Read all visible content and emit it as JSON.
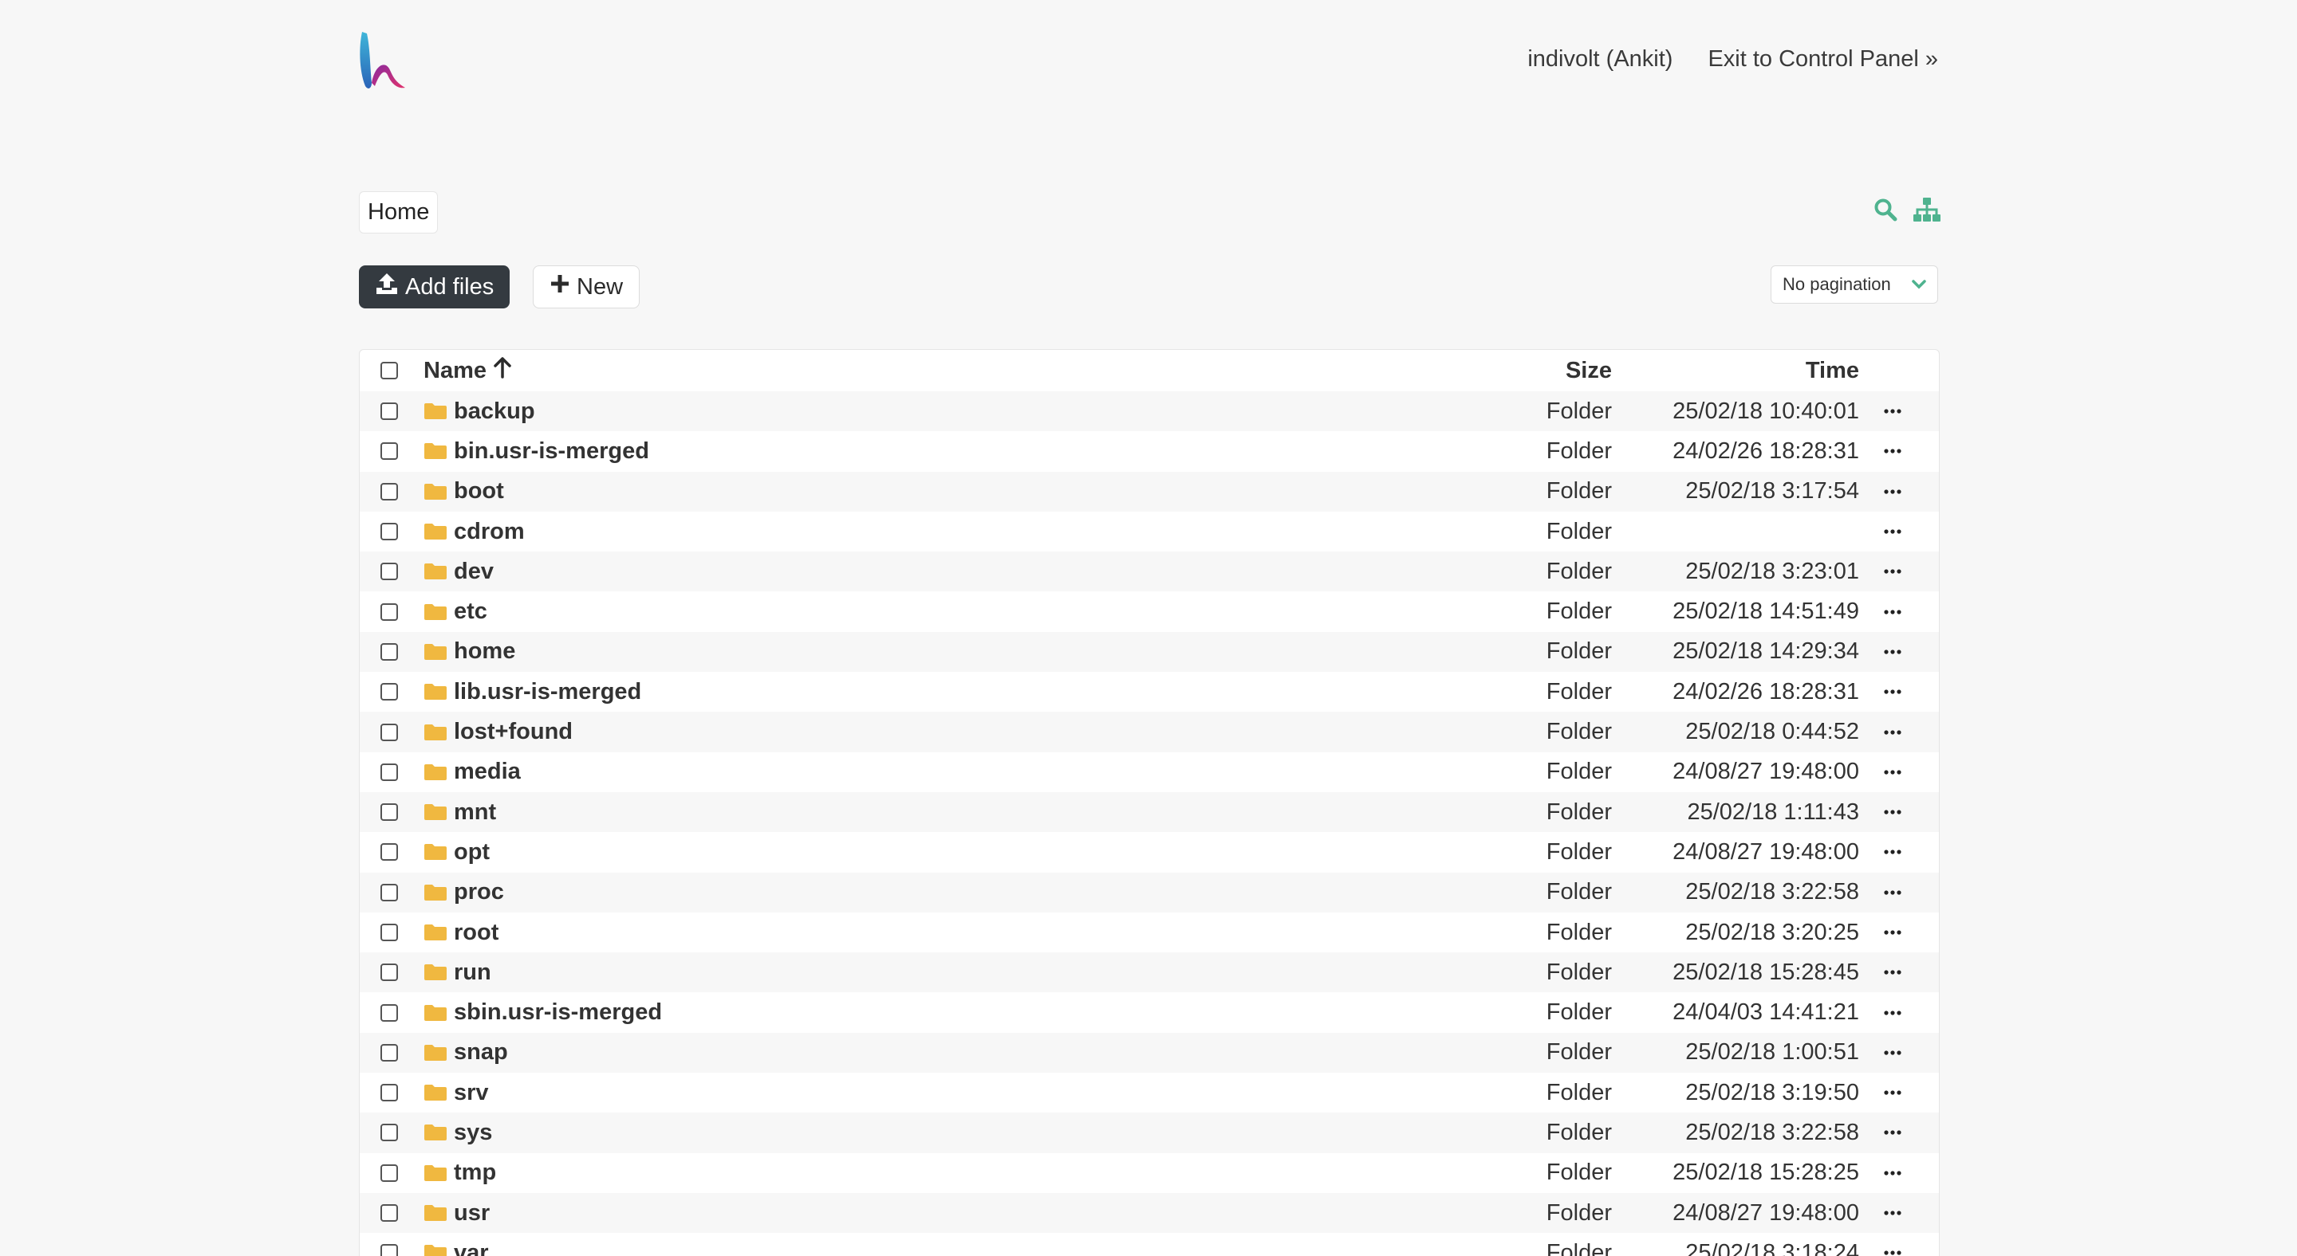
{
  "header": {
    "user": "indivolt (Ankit)",
    "exit_link": "Exit to Control Panel »"
  },
  "breadcrumb": {
    "home": "Home"
  },
  "toolbar": {
    "add_files": "Add files",
    "new": "New",
    "pagination": "No pagination"
  },
  "table": {
    "columns": {
      "name": "Name",
      "size": "Size",
      "time": "Time"
    },
    "rows": [
      {
        "name": "backup",
        "size": "Folder",
        "time": "25/02/18 10:40:01"
      },
      {
        "name": "bin.usr-is-merged",
        "size": "Folder",
        "time": "24/02/26 18:28:31"
      },
      {
        "name": "boot",
        "size": "Folder",
        "time": "25/02/18 3:17:54"
      },
      {
        "name": "cdrom",
        "size": "Folder",
        "time": ""
      },
      {
        "name": "dev",
        "size": "Folder",
        "time": "25/02/18 3:23:01"
      },
      {
        "name": "etc",
        "size": "Folder",
        "time": "25/02/18 14:51:49"
      },
      {
        "name": "home",
        "size": "Folder",
        "time": "25/02/18 14:29:34"
      },
      {
        "name": "lib.usr-is-merged",
        "size": "Folder",
        "time": "24/02/26 18:28:31"
      },
      {
        "name": "lost+found",
        "size": "Folder",
        "time": "25/02/18 0:44:52"
      },
      {
        "name": "media",
        "size": "Folder",
        "time": "24/08/27 19:48:00"
      },
      {
        "name": "mnt",
        "size": "Folder",
        "time": "25/02/18 1:11:43"
      },
      {
        "name": "opt",
        "size": "Folder",
        "time": "24/08/27 19:48:00"
      },
      {
        "name": "proc",
        "size": "Folder",
        "time": "25/02/18 3:22:58"
      },
      {
        "name": "root",
        "size": "Folder",
        "time": "25/02/18 3:20:25"
      },
      {
        "name": "run",
        "size": "Folder",
        "time": "25/02/18 15:28:45"
      },
      {
        "name": "sbin.usr-is-merged",
        "size": "Folder",
        "time": "24/04/03 14:41:21"
      },
      {
        "name": "snap",
        "size": "Folder",
        "time": "25/02/18 1:00:51"
      },
      {
        "name": "srv",
        "size": "Folder",
        "time": "25/02/18 3:19:50"
      },
      {
        "name": "sys",
        "size": "Folder",
        "time": "25/02/18 3:22:58"
      },
      {
        "name": "tmp",
        "size": "Folder",
        "time": "25/02/18 15:28:25"
      },
      {
        "name": "usr",
        "size": "Folder",
        "time": "24/08/27 19:48:00"
      },
      {
        "name": "var",
        "size": "Folder",
        "time": "25/02/18 3:18:24"
      }
    ]
  },
  "icons": {
    "folder": "folder-icon",
    "search": "search-icon",
    "tree": "sitemap-icon",
    "upload": "upload-icon",
    "plus": "plus-icon",
    "sort": "arrow-up-icon",
    "more": "ellipsis-icon",
    "chevron": "chevron-down-icon"
  },
  "colors": {
    "accent": "#4fb38f",
    "folder": "#f0b840",
    "dark_button": "#343a40"
  }
}
